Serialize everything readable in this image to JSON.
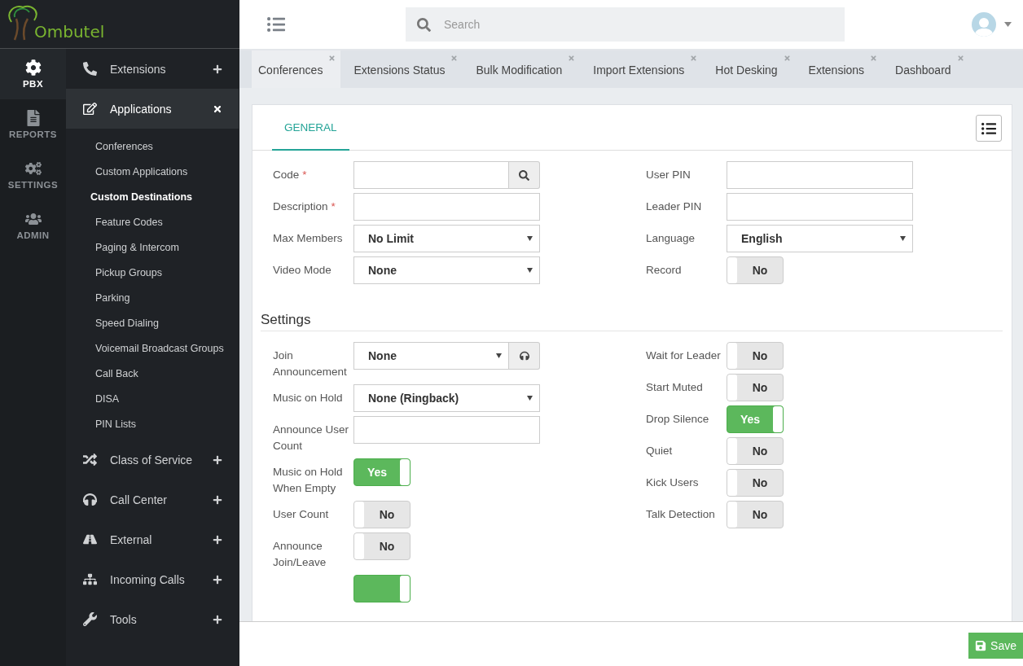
{
  "logo": {
    "text": "Ombutel"
  },
  "rail": [
    {
      "label": "PBX",
      "selected": true
    },
    {
      "label": "REPORTS",
      "selected": false
    },
    {
      "label": "SETTINGS",
      "selected": false
    },
    {
      "label": "ADMIN",
      "selected": false
    }
  ],
  "menu": [
    {
      "label": "Extensions",
      "expanded": false
    },
    {
      "label": "Applications",
      "expanded": true,
      "children": [
        {
          "label": "Conferences",
          "selected": false
        },
        {
          "label": "Custom Applications",
          "selected": false
        },
        {
          "label": "Custom Destinations",
          "selected": true
        },
        {
          "label": "Feature Codes",
          "selected": false
        },
        {
          "label": "Paging & Intercom",
          "selected": false
        },
        {
          "label": "Pickup Groups",
          "selected": false
        },
        {
          "label": "Parking",
          "selected": false
        },
        {
          "label": "Speed Dialing",
          "selected": false
        },
        {
          "label": "Voicemail Broadcast Groups",
          "selected": false
        },
        {
          "label": "Call Back",
          "selected": false
        },
        {
          "label": "DISA",
          "selected": false
        },
        {
          "label": "PIN Lists",
          "selected": false
        }
      ]
    },
    {
      "label": "Class of Service",
      "expanded": false
    },
    {
      "label": "Call Center",
      "expanded": false
    },
    {
      "label": "External",
      "expanded": false
    },
    {
      "label": "Incoming Calls",
      "expanded": false
    },
    {
      "label": "Tools",
      "expanded": false
    }
  ],
  "topbar": {
    "search": {
      "placeholder": "Search"
    }
  },
  "tabs": [
    {
      "label": "Conferences",
      "selected": true
    },
    {
      "label": "Extensions Status",
      "selected": false
    },
    {
      "label": "Bulk Modification",
      "selected": false
    },
    {
      "label": "Import Extensions",
      "selected": false
    },
    {
      "label": "Hot Desking",
      "selected": false
    },
    {
      "label": "Extensions",
      "selected": false
    },
    {
      "label": "Dashboard",
      "selected": false
    }
  ],
  "panel": {
    "tabs": [
      {
        "label": "GENERAL",
        "selected": true
      }
    ],
    "left": [
      {
        "kind": "search_input",
        "label": "Code",
        "mark": "*"
      },
      {
        "kind": "input",
        "label": "Description",
        "mark": "*"
      },
      {
        "kind": "select",
        "label": "Max Members",
        "value": "No Limit"
      },
      {
        "kind": "select",
        "label": "Video Mode",
        "value": "None"
      }
    ],
    "right": [
      {
        "kind": "input",
        "label": "User PIN"
      },
      {
        "kind": "input",
        "label": "Leader PIN"
      },
      {
        "kind": "select",
        "label": "Language",
        "value": "English"
      },
      {
        "kind": "toggle",
        "label": "Record",
        "on": false,
        "value": "No"
      }
    ],
    "settings": {
      "title": "Settings",
      "left": [
        {
          "kind": "select_button",
          "label": "Join Announcement",
          "value": "None"
        },
        {
          "kind": "select",
          "label": "Music on Hold",
          "value": "None (Ringback)"
        },
        {
          "kind": "input",
          "label": "Announce User Count"
        },
        {
          "kind": "toggle",
          "label": "Music on Hold When Empty",
          "on": true,
          "value": "Yes"
        },
        {
          "kind": "toggle",
          "label": "User Count",
          "on": false,
          "value": "No"
        },
        {
          "kind": "toggle",
          "label": "Announce Join/Leave",
          "on": false,
          "value": "No"
        },
        {
          "kind": "toggle",
          "on": true
        }
      ],
      "right": [
        {
          "kind": "toggle",
          "label": "Wait for Leader",
          "on": false,
          "value": "No"
        },
        {
          "kind": "toggle",
          "label": "Start Muted",
          "on": false,
          "value": "No"
        },
        {
          "kind": "toggle",
          "label": "Drop Silence",
          "on": true,
          "value": "Yes"
        },
        {
          "kind": "toggle",
          "label": "Quiet",
          "on": false,
          "value": "No"
        },
        {
          "kind": "toggle",
          "label": "Kick Users",
          "on": false,
          "value": "No"
        },
        {
          "kind": "toggle",
          "label": "Talk Detection",
          "on": false,
          "value": "No"
        }
      ]
    }
  },
  "footer": {
    "save": "Save"
  }
}
